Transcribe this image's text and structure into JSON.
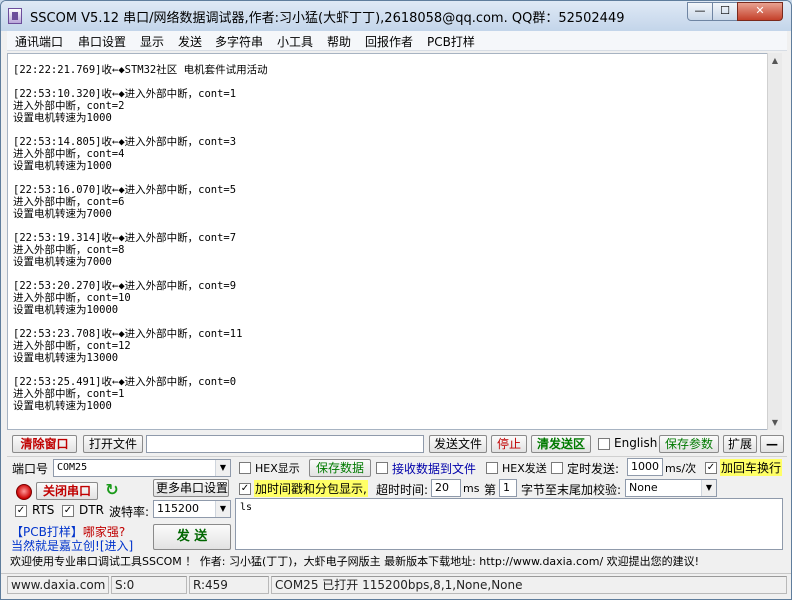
{
  "window": {
    "title": "SSCOM V5.12 串口/网络数据调试器,作者:习小猛(大虾丁丁),2618058@qq.com. QQ群：52502449",
    "min_glyph": "—",
    "max_glyph": "☐",
    "close_glyph": "✕"
  },
  "menu": [
    {
      "label": "通讯端口"
    },
    {
      "label": "串口设置"
    },
    {
      "label": "显示"
    },
    {
      "label": "发送"
    },
    {
      "label": "多字符串"
    },
    {
      "label": "小工具"
    },
    {
      "label": "帮助"
    },
    {
      "label": "回报作者"
    },
    {
      "label": "PCB打样"
    }
  ],
  "log_text": "[22:22:21.769]收←◆STM32社区 电机套件试用活动\n\n[22:53:10.320]收←◆进入外部中断，cont=1\n进入外部中断，cont=2\n设置电机转速为1000\n\n[22:53:14.805]收←◆进入外部中断，cont=3\n进入外部中断，cont=4\n设置电机转速为1000\n\n[22:53:16.070]收←◆进入外部中断，cont=5\n进入外部中断，cont=6\n设置电机转速为7000\n\n[22:53:19.314]收←◆进入外部中断，cont=7\n进入外部中断，cont=8\n设置电机转速为7000\n\n[22:53:20.270]收←◆进入外部中断，cont=9\n进入外部中断，cont=10\n设置电机转速为10000\n\n[22:53:23.708]收←◆进入外部中断，cont=11\n进入外部中断，cont=12\n设置电机转速为13000\n\n[22:53:25.491]收←◆进入外部中断，cont=0\n进入外部中断，cont=1\n设置电机转速为1000",
  "toolbar": {
    "clear_window": "清除窗口",
    "open_file": "打开文件",
    "file_path": "",
    "send_file": "发送文件",
    "stop": "停止",
    "clear_send": "清发送区",
    "english": "English",
    "english_checked": "",
    "save_params": "保存参数",
    "expand": "扩展",
    "collapse": "—"
  },
  "port": {
    "label": "端口号",
    "value": "COM25",
    "close_port": "关闭串口",
    "more_settings": "更多串口设置",
    "rts_label": "RTS",
    "rts_checked": "✓",
    "dtr_label": "DTR",
    "dtr_checked": "✓",
    "baud_label": "波特率:",
    "baud_value": "115200",
    "send_button": "发 送"
  },
  "options": {
    "hex_display": "HEX显示",
    "hex_display_checked": "",
    "save_data": "保存数据",
    "recv_to_file": "接收数据到文件",
    "recv_to_file_checked": "",
    "hex_send": "HEX发送",
    "hex_send_checked": "",
    "timed_send": "定时发送:",
    "timed_send_checked": "",
    "interval_value": "1000",
    "interval_unit": "ms/次",
    "add_crlf": "加回车换行",
    "add_crlf_checked": "✓",
    "add_timestamp": "加时间戳和分包显示,",
    "add_timestamp_checked": "✓",
    "timeout_label": "超时时间:",
    "timeout_value": "20",
    "timeout_unit": "ms",
    "nth_label": "第",
    "nth_value": "1",
    "checksum_label": "字节至末尾加校验:",
    "checksum_value": "None"
  },
  "send_text": "ls",
  "promo": {
    "line1_pcb": "【PCB打样】",
    "line1_rest": "哪家强?",
    "line2": "当然就是嘉立创!",
    "line2_link": "[进入]"
  },
  "info_line": "欢迎使用专业串口调试工具SSCOM ！  作者: 习小猛(丁丁)，大虾电子网版主  最新版本下载地址: http://www.daxia.com/  欢迎提出您的建议!",
  "statusbar": {
    "site": "www.daxia.com",
    "sent": "S:0",
    "received": "R:459",
    "port_status": "COM25 已打开  115200bps,8,1,None,None"
  }
}
